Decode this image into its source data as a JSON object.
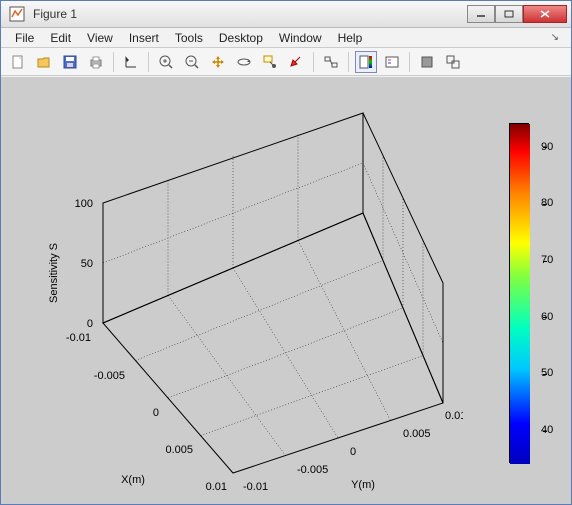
{
  "window": {
    "title": "Figure 1"
  },
  "menu": {
    "file": "File",
    "edit": "Edit",
    "view": "View",
    "insert": "Insert",
    "tools": "Tools",
    "desktop": "Desktop",
    "window": "Window",
    "help": "Help"
  },
  "axes": {
    "xlabel": "X(m)",
    "ylabel": "Y(m)",
    "zlabel": "Sensitivity S",
    "xticks": [
      "-0.01",
      "-0.005",
      "0",
      "0.005",
      "0.01"
    ],
    "yticks": [
      "-0.01",
      "-0.005",
      "0",
      "0.005",
      "0.01"
    ],
    "zticks": [
      "0",
      "50",
      "100"
    ]
  },
  "colorbar": {
    "ticks": [
      "40",
      "50",
      "60",
      "70",
      "80",
      "90"
    ],
    "min": 35,
    "max": 95
  },
  "chart_data": {
    "type": "heatmap",
    "title": "",
    "xlabel": "X(m)",
    "ylabel": "Y(m)",
    "zlabel": "Sensitivity S",
    "xlim": [
      -0.01,
      0.01
    ],
    "ylim": [
      -0.01,
      0.01
    ],
    "zlim": [
      0,
      100
    ],
    "colorbar_range": [
      35,
      95
    ],
    "series": []
  }
}
